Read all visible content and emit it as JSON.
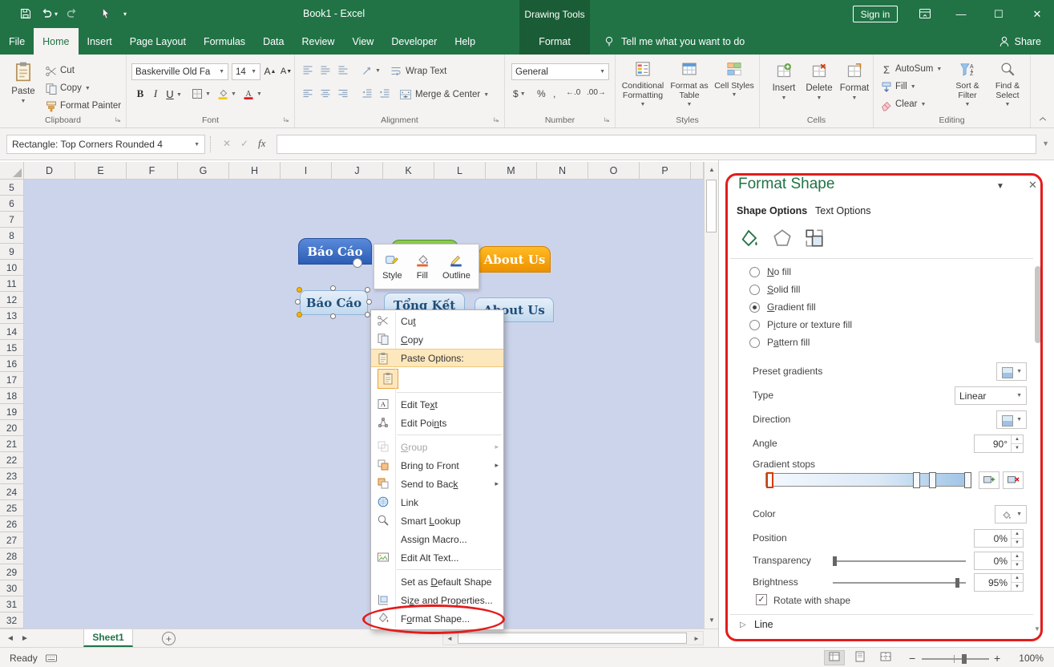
{
  "titlebar": {
    "title": "Book1 - Excel",
    "contextual_tool": "Drawing Tools",
    "sign_in_label": "Sign in"
  },
  "ribbon": {
    "tabs": [
      {
        "label": "File",
        "state": "file"
      },
      {
        "label": "Home",
        "state": "active"
      },
      {
        "label": "Insert"
      },
      {
        "label": "Page Layout"
      },
      {
        "label": "Formulas"
      },
      {
        "label": "Data"
      },
      {
        "label": "Review"
      },
      {
        "label": "View"
      },
      {
        "label": "Developer"
      },
      {
        "label": "Help"
      }
    ],
    "contextual_tab": "Format",
    "tell_me": "Tell me what you want to do",
    "share_label": "Share",
    "clipboard": {
      "group_label": "Clipboard",
      "paste": "Paste",
      "cut": "Cut",
      "copy": "Copy",
      "format_painter": "Format Painter"
    },
    "font": {
      "group_label": "Font",
      "font_name": "Baskerville Old Fa",
      "font_size": "14",
      "bold": "B",
      "italic": "I",
      "underline": "U"
    },
    "alignment": {
      "group_label": "Alignment",
      "wrap_text": "Wrap Text",
      "merge_center": "Merge & Center"
    },
    "number": {
      "group_label": "Number",
      "format": "General",
      "currency": "$",
      "percent": "%",
      "comma": ",",
      "inc_decimal": "←.0",
      "dec_decimal": ".00→"
    },
    "styles": {
      "group_label": "Styles",
      "conditional": "Conditional Formatting",
      "format_table": "Format as Table",
      "cell_styles": "Cell Styles"
    },
    "cells": {
      "group_label": "Cells",
      "insert": "Insert",
      "delete": "Delete",
      "format": "Format"
    },
    "editing": {
      "group_label": "Editing",
      "autosum": "AutoSum",
      "fill": "Fill",
      "clear": "Clear",
      "sort_filter": "Sort & Filter",
      "find_select": "Find & Select"
    }
  },
  "formula_bar": {
    "name_box": "Rectangle: Top Corners Rounded 4",
    "fx_label": "fx"
  },
  "grid": {
    "columns": [
      "D",
      "E",
      "F",
      "G",
      "H",
      "I",
      "J",
      "K",
      "L",
      "M",
      "N",
      "O",
      "P"
    ],
    "row_start": 5,
    "row_end": 32
  },
  "shapes": {
    "report_top": "Báo Cáo",
    "about_top": "About Us",
    "report_mid": "Báo Cáo",
    "summary_mid": "Tổng Kết",
    "about_mid": "About Us"
  },
  "mini_toolbar": {
    "items": [
      {
        "label": "Style",
        "icon": "style-icon"
      },
      {
        "label": "Fill",
        "icon": "fill-bucket-icon"
      },
      {
        "label": "Outline",
        "icon": "outline-pencil-icon"
      }
    ]
  },
  "context_menu": {
    "items": [
      {
        "type": "item",
        "label": "Cut",
        "key": "t",
        "icon": "scissors"
      },
      {
        "type": "item",
        "label": "Copy",
        "key": "C",
        "icon": "copy"
      },
      {
        "type": "item",
        "label": "Paste Options:",
        "key": "",
        "icon": "clipboard",
        "highlight": true
      },
      {
        "type": "paste-thumb",
        "icon": "clipboard"
      },
      {
        "type": "sep"
      },
      {
        "type": "item",
        "label": "Edit Text",
        "key": "x",
        "icon": "edit-text"
      },
      {
        "type": "item",
        "label": "Edit Points",
        "key": "n",
        "icon": "edit-points"
      },
      {
        "type": "sep"
      },
      {
        "type": "item",
        "label": "Group",
        "key": "G",
        "icon": "group",
        "disabled": true,
        "submenu": true
      },
      {
        "type": "item",
        "label": "Bring to Front",
        "key": "",
        "icon": "bring-front",
        "submenu": true
      },
      {
        "type": "item",
        "label": "Send to Back",
        "key": "k",
        "icon": "send-back",
        "submenu": true
      },
      {
        "type": "item",
        "label": "Link",
        "key": "",
        "icon": "link"
      },
      {
        "type": "item",
        "label": "Smart Lookup",
        "key": "L",
        "icon": "smart-lookup"
      },
      {
        "type": "item",
        "label": "Assign Macro...",
        "key": "",
        "icon": ""
      },
      {
        "type": "item",
        "label": "Edit Alt Text...",
        "key": "",
        "icon": "alt-text"
      },
      {
        "type": "sep"
      },
      {
        "type": "item",
        "label": "Set as Default Shape",
        "key": "D",
        "icon": ""
      },
      {
        "type": "item",
        "label": "Size and Properties...",
        "key": "z",
        "icon": "size-props"
      },
      {
        "type": "item",
        "label": "Format Shape...",
        "key": "o",
        "icon": "format-shape",
        "annotated": true
      }
    ]
  },
  "format_pane": {
    "title": "Format Shape",
    "tab_shape": "Shape Options",
    "tab_text": "Text Options",
    "fill_options": [
      {
        "label": "No fill",
        "key": "N",
        "selected": false
      },
      {
        "label": "Solid fill",
        "key": "S",
        "selected": false
      },
      {
        "label": "Gradient fill",
        "key": "G",
        "selected": true
      },
      {
        "label": "Picture or texture fill",
        "key": "i",
        "selected": false
      },
      {
        "label": "Pattern fill",
        "key": "a",
        "selected": false
      }
    ],
    "preset_label": "Preset gradients",
    "type_label": "Type",
    "type_value": "Linear",
    "direction_label": "Direction",
    "angle_label": "Angle",
    "angle_value": "90°",
    "stops_label": "Gradient stops",
    "gradient_stops_positions": [
      0,
      74,
      82,
      100
    ],
    "color_label": "Color",
    "position_label": "Position",
    "position_value": "0%",
    "transparency_label": "Transparency",
    "transparency_value": "0%",
    "transparency_pct": 0,
    "brightness_label": "Brightness",
    "brightness_value": "95%",
    "brightness_pct": 95,
    "rotate_label": "Rotate with shape",
    "rotate_checked": true,
    "line_label": "Line"
  },
  "sheet_bar": {
    "sheet_name": "Sheet1"
  },
  "status_bar": {
    "ready": "Ready",
    "zoom": "100%"
  }
}
